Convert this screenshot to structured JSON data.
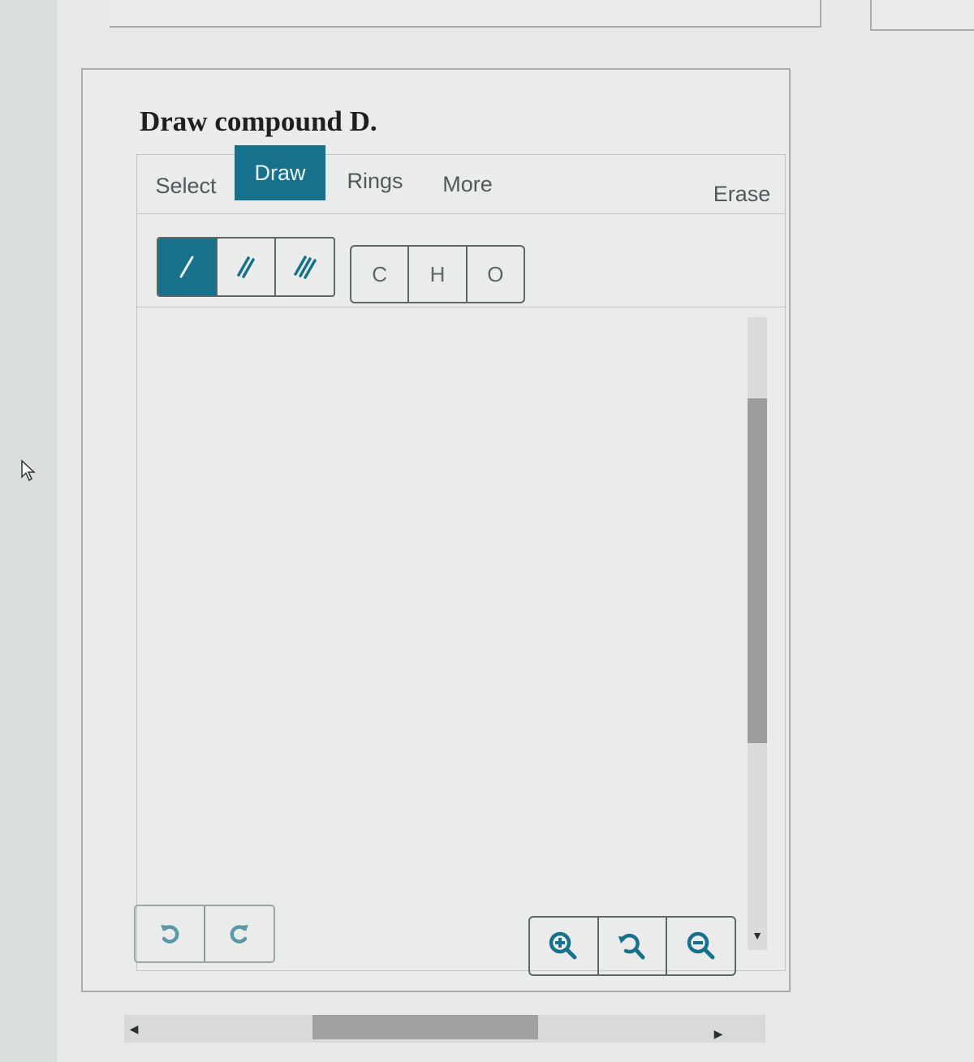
{
  "question": {
    "title": "Draw compound D."
  },
  "editor": {
    "tabs": [
      {
        "label": "Select",
        "active": false
      },
      {
        "label": "Draw",
        "active": true
      },
      {
        "label": "Rings",
        "active": false
      },
      {
        "label": "More",
        "active": false
      }
    ],
    "erase_label": "Erase",
    "bonds": [
      {
        "name": "single-bond",
        "icon": "single-bond-icon",
        "active": true
      },
      {
        "name": "double-bond",
        "icon": "double-bond-icon",
        "active": false
      },
      {
        "name": "triple-bond",
        "icon": "triple-bond-icon",
        "active": false
      }
    ],
    "atoms": [
      "C",
      "H",
      "O"
    ],
    "history": [
      {
        "name": "undo",
        "icon": "undo-icon"
      },
      {
        "name": "redo",
        "icon": "redo-icon"
      }
    ],
    "zoom_controls": [
      {
        "name": "zoom-in",
        "icon": "zoom-in-icon"
      },
      {
        "name": "zoom-reset",
        "icon": "zoom-reset-icon"
      },
      {
        "name": "zoom-out",
        "icon": "zoom-out-icon"
      }
    ],
    "scroll": {
      "vertical_position_fraction": 0.15,
      "horizontal_position_fraction": 0.35
    }
  },
  "colors": {
    "accent": "#18718a",
    "tab_text": "#4e5a5b",
    "border": "#5c6766",
    "scroll_thumb": "#9c9e9d"
  }
}
